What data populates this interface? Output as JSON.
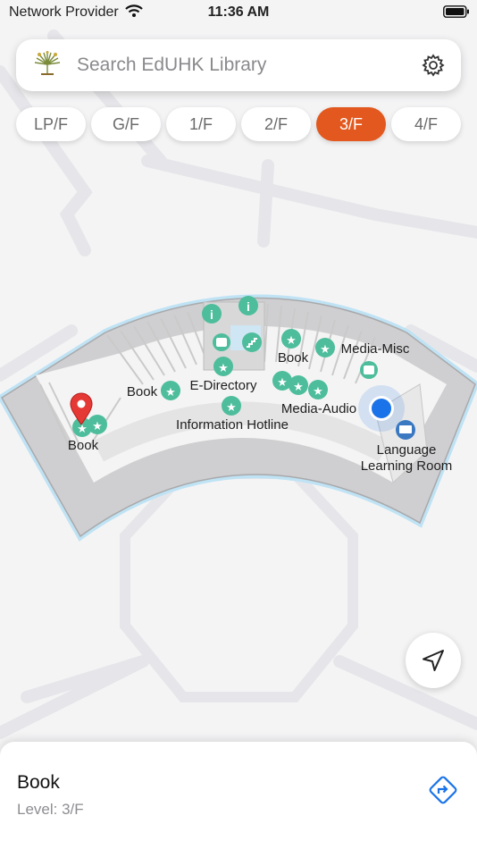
{
  "status_bar": {
    "carrier": "Network Provider",
    "time": "11:36 AM"
  },
  "search": {
    "placeholder": "Search EdUHK Library"
  },
  "floors": {
    "tabs": [
      {
        "label": "LP/F"
      },
      {
        "label": "G/F"
      },
      {
        "label": "1/F"
      },
      {
        "label": "2/F"
      },
      {
        "label": "3/F"
      },
      {
        "label": "4/F"
      }
    ],
    "active": "3/F"
  },
  "map": {
    "labels": {
      "book_left": "Book",
      "book_mid": "Book",
      "book_upper": "Book",
      "e_directory": "E-Directory",
      "media_misc": "Media-Misc",
      "media_audio": "Media-Audio",
      "information_hotline": "Information Hotline",
      "language_line1": "Language",
      "language_line2": "Learning Room"
    }
  },
  "selection": {
    "title": "Book",
    "level": "Level: 3/F"
  },
  "colors": {
    "accent": "#e2581e",
    "poi": "#4dbd9b",
    "pin": "#e53935",
    "user_dot": "#1a73e8",
    "link": "#1a73e8"
  }
}
